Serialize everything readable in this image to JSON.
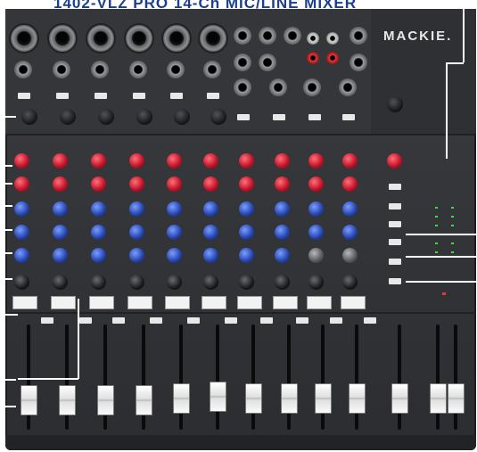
{
  "header": {
    "title": "1402-VLZ PRO 14-Ch MIC/LINE MIXER"
  },
  "brand": {
    "name": "MACKIE."
  },
  "mixer": {
    "mono_channels": 10,
    "stereo_channels": 2,
    "knob_colors": {
      "hi": "#c4162b",
      "mid": "#2749b2",
      "pan": "#1a1b1d",
      "aux": "#5c5f64"
    }
  }
}
